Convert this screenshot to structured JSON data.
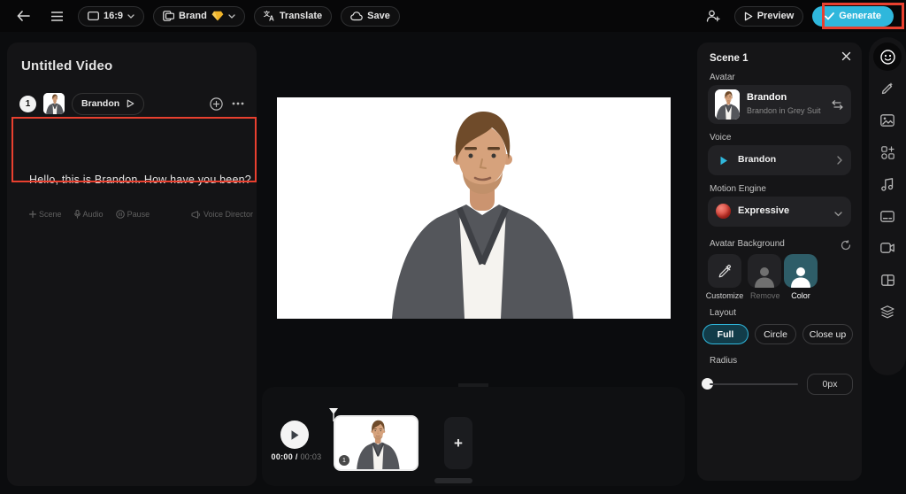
{
  "topbar": {
    "aspect_ratio": "16:9",
    "brand_label": "Brand",
    "translate_label": "Translate",
    "save_label": "Save",
    "preview_label": "Preview",
    "generate_label": "Generate"
  },
  "left_panel": {
    "title": "Untitled Video",
    "scene_index": "1",
    "avatar_chip_name": "Brandon",
    "script_text": "Hello, this is Brandon. How have you been?",
    "script_actions": {
      "scene": "Scene",
      "audio": "Audio",
      "pause": "Pause",
      "voice_director": "Voice Director"
    }
  },
  "timeline": {
    "current_time": "00:00",
    "separator": " / ",
    "total_time": "00:03",
    "clip_badge": "1",
    "add_label": "+"
  },
  "right_panel": {
    "title": "Scene 1",
    "avatar_label": "Avatar",
    "avatar_name": "Brandon",
    "avatar_description": "Brandon in Grey Suit",
    "voice_label": "Voice",
    "voice_name": "Brandon",
    "motion_label": "Motion Engine",
    "motion_value": "Expressive",
    "background_label": "Avatar Background",
    "background_options": [
      "Customize",
      "Remove",
      "Color"
    ],
    "layout_label": "Layout",
    "layout_options": [
      "Full",
      "Circle",
      "Close up"
    ],
    "radius_label": "Radius",
    "radius_value": "0px"
  },
  "colors": {
    "accent_cyan": "#2fb7dc",
    "highlight_red": "#e8402f",
    "color_tile_teal": "#2e5d68",
    "motion_orb_red": "#d5382c",
    "brand_gem_gold": "#f0b429"
  },
  "icons": {
    "topbar": [
      "back-icon",
      "menu-icon",
      "display-icon",
      "chevron-down-icon",
      "brand-kit-icon",
      "gem-icon",
      "translate-icon",
      "cloud-save-icon",
      "invite-collaborator-icon",
      "play-outline-icon",
      "check-icon"
    ],
    "script": [
      "plus-icon",
      "mic-icon",
      "pause-icon",
      "megaphone-icon"
    ],
    "rail": [
      "avatar-icon",
      "draw-icon",
      "media-icon",
      "elements-icon",
      "music-icon",
      "captions-icon",
      "camera-icon",
      "layout-icon",
      "layers-icon"
    ]
  }
}
